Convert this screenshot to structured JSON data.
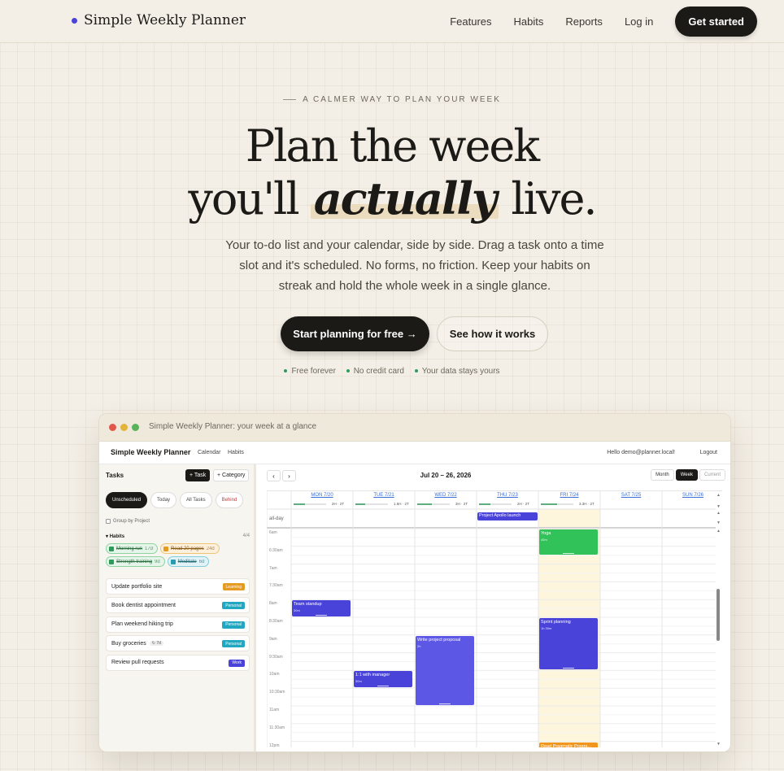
{
  "nav": {
    "brand": "Simple Weekly Planner",
    "links": [
      "Features",
      "Habits",
      "Reports",
      "Log in"
    ],
    "cta": "Get started"
  },
  "hero": {
    "eyebrow": "A CALMER WAY TO PLAN YOUR WEEK",
    "title_line1": "Plan the week",
    "title_line2_pre": "you'll",
    "title_line2_accent": "actually",
    "title_line2_post": "live.",
    "subtitle": "Your to-do list and your calendar, side by side. Drag a task onto a time slot and it's scheduled. No forms, no friction. Keep your habits on streak and hold the whole week in a single glance.",
    "primary_cta": "Start planning for free →",
    "secondary_cta": "See how it works",
    "perks": [
      "Free forever",
      "No credit card",
      "Your data stays yours"
    ]
  },
  "window": {
    "title": "Simple Weekly Planner: your week at a glance"
  },
  "app": {
    "brand": "Simple Weekly Planner",
    "nav_links": [
      "Calendar",
      "Habits"
    ],
    "user": "Hello demo@planner.local!",
    "logout": "Logout",
    "sidebar": {
      "title": "Tasks",
      "add_task": "+ Task",
      "add_category": "+ Category",
      "filters": [
        "Unscheduled",
        "Today",
        "All Tasks",
        "Behind"
      ],
      "group_by_project": "Group by Project",
      "habits_label": "Habits",
      "habits_count": "4/4",
      "habits": [
        {
          "name": "Morning run",
          "streak": "17d",
          "color": "green"
        },
        {
          "name": "Read 20 pages",
          "streak": "24d",
          "color": "orange"
        },
        {
          "name": "Strength training",
          "streak": "9d",
          "color": "green"
        },
        {
          "name": "Meditate",
          "streak": "6d",
          "color": "teal"
        }
      ],
      "tasks": [
        {
          "title": "Update portfolio site",
          "tag": "Learning",
          "tag_color": "learning",
          "recur": ""
        },
        {
          "title": "Book dentist appointment",
          "tag": "Personal",
          "tag_color": "personal",
          "recur": ""
        },
        {
          "title": "Plan weekend hiking trip",
          "tag": "Personal",
          "tag_color": "personal",
          "recur": ""
        },
        {
          "title": "Buy groceries",
          "tag": "Personal",
          "tag_color": "personal",
          "recur": "↻ 7d"
        },
        {
          "title": "Review pull requests",
          "tag": "Work",
          "tag_color": "work",
          "recur": ""
        }
      ]
    },
    "calendar": {
      "range": "Jul 20 – 26, 2026",
      "views": [
        "Month",
        "Week",
        "Current"
      ],
      "active_view": "Week",
      "allday_label": "all-day",
      "days": [
        {
          "label": "MON 7/20",
          "load": "2H · 2T",
          "fill": 0.35
        },
        {
          "label": "TUE 7/21",
          "load": "1.5H · 2T",
          "fill": 0.3
        },
        {
          "label": "WED 7/22",
          "load": "3H · 2T",
          "fill": 0.45
        },
        {
          "label": "THU 7/23",
          "load": "2H · 2T",
          "fill": 0.35
        },
        {
          "label": "FRI 7/24",
          "load": "3.3H · 2T",
          "fill": 0.5
        },
        {
          "label": "SAT 7/25",
          "load": "",
          "fill": 0
        },
        {
          "label": "SUN 7/26",
          "load": "",
          "fill": 0
        }
      ],
      "hours": [
        "6am",
        "6:30am",
        "7am",
        "7:30am",
        "8am",
        "8:30am",
        "9am",
        "9:30am",
        "10am",
        "10:30am",
        "11am",
        "11:30am",
        "12pm"
      ],
      "allday_events": [
        {
          "title": "Project Apollo launch",
          "day": 3
        }
      ],
      "events": [
        {
          "title": "Yoga",
          "duration": "45m",
          "day": 4,
          "start": 0.0,
          "hours": 0.75,
          "color": "green"
        },
        {
          "title": "Team standup",
          "duration": "30m",
          "day": 0,
          "start": 2.0,
          "hours": 0.5,
          "color": "indigo"
        },
        {
          "title": "Sprint planning",
          "duration": "1h 30m",
          "day": 4,
          "start": 2.5,
          "hours": 1.5,
          "color": "indigo"
        },
        {
          "title": "Write project proposal",
          "duration": "2h",
          "day": 2,
          "start": 3.0,
          "hours": 2.0,
          "color": "indigo2"
        },
        {
          "title": "1:1 with manager",
          "duration": "30m",
          "day": 1,
          "start": 4.0,
          "hours": 0.5,
          "color": "indigo"
        },
        {
          "title": "Read Pragmatic Progra...",
          "duration": "",
          "day": 4,
          "start": 6.0,
          "hours": 0.25,
          "color": "orange"
        }
      ],
      "today_index": 4,
      "colors": {
        "today_bg": "#fdf6dc",
        "load_bar": "#2e9a5b"
      }
    }
  }
}
